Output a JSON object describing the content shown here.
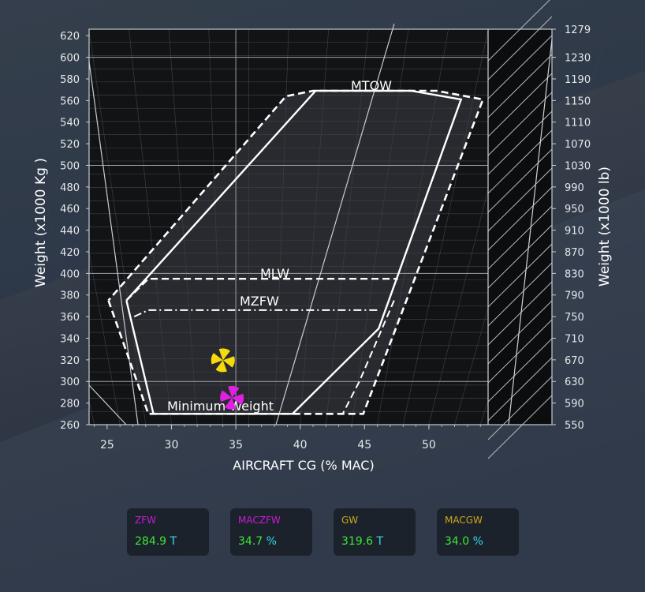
{
  "chart_data": {
    "type": "envelope",
    "xlabel": "AIRCRAFT CG (% MAC)",
    "ylabel_left": "Weight (x1000 Kg )",
    "ylabel_right": "Weight (x1000 lb)",
    "x_ticks": [
      "25",
      "30",
      "35",
      "40",
      "45",
      "50"
    ],
    "x_tick_values": [
      25,
      30,
      35,
      40,
      45,
      50
    ],
    "y_ticks_left": [
      "260",
      "280",
      "300",
      "320",
      "340",
      "360",
      "380",
      "400",
      "420",
      "440",
      "460",
      "480",
      "500",
      "520",
      "540",
      "560",
      "580",
      "600",
      "620"
    ],
    "y_ticks_right": [
      "550",
      "590",
      "630",
      "670",
      "710",
      "750",
      "790",
      "830",
      "870",
      "910",
      "950",
      "990",
      "1030",
      "1070",
      "1110",
      "1150",
      "1190",
      "1230",
      "1279"
    ],
    "xlim": [
      23.6,
      54.6
    ],
    "ylim": [
      260,
      626
    ],
    "labels": {
      "mtow": "MTOW",
      "mlw": "MLW",
      "mzfw": "MZFW",
      "min_weight": "Minimum Weight"
    },
    "points": {
      "gw": {
        "cg": 34.0,
        "weight": 319.6,
        "color": "#f5d90a"
      },
      "zfw": {
        "cg": 34.7,
        "weight": 284.9,
        "color": "#e020e0"
      }
    },
    "envelopes": {
      "outer_dashed": [
        [
          25.1,
          375
        ],
        [
          28.2,
          270
        ],
        [
          44.9,
          270
        ],
        [
          54.2,
          561
        ],
        [
          50.6,
          569
        ],
        [
          41.0,
          569
        ],
        [
          38.9,
          564
        ],
        [
          25.1,
          375
        ]
      ],
      "inner_solid": [
        [
          26.5,
          375
        ],
        [
          28.6,
          270
        ],
        [
          39.4,
          270
        ],
        [
          46.1,
          349
        ],
        [
          52.5,
          561
        ],
        [
          48.6,
          569
        ],
        [
          41.2,
          569
        ],
        [
          26.5,
          375
        ]
      ],
      "mlw_line": [
        [
          26.5,
          375
        ],
        [
          28.2,
          395
        ],
        [
          47.6,
          395
        ]
      ],
      "mzfw_line": [
        [
          27.1,
          360
        ],
        [
          28.2,
          366
        ],
        [
          46.2,
          366
        ]
      ],
      "mlw_aft_dashed": [
        [
          47.3,
          375
        ],
        [
          44.6,
          300
        ],
        [
          43.3,
          270
        ]
      ]
    }
  },
  "readouts": [
    {
      "label": "ZFW",
      "value": "284.9",
      "unit": "T",
      "label_color": "#c81ad8"
    },
    {
      "label": "MACZFW",
      "value": "34.7",
      "unit": "%",
      "label_color": "#c81ad8"
    },
    {
      "label": "GW",
      "value": "319.6",
      "unit": "T",
      "label_color": "#c9a916"
    },
    {
      "label": "MACGW",
      "value": "34.0",
      "unit": "%",
      "label_color": "#c9a916"
    }
  ],
  "colors": {
    "background_top": "#3b4250",
    "background_bottom": "#2a3344",
    "plot_bg": "#101214",
    "value_green": "#39e639",
    "unit_cyan": "#38d8e8"
  }
}
